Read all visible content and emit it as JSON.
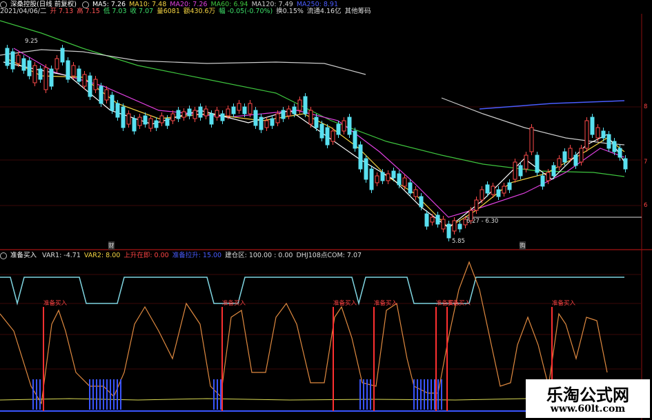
{
  "header": {
    "title": "深桑控股(日线 前复权)",
    "ma": [
      {
        "label": "MA5: 7.26",
        "color": "#ffffff"
      },
      {
        "label": "MA10: 7.48",
        "color": "#f5d442"
      },
      {
        "label": "MA20: 7.26",
        "color": "#e040e0"
      },
      {
        "label": "MA60: 6.94",
        "color": "#3ec43e"
      },
      {
        "label": "MA120: 7.49",
        "color": "#cccccc"
      },
      {
        "label": "MA250: 8.91",
        "color": "#4a5cff"
      }
    ],
    "date": "2021/04/06/二",
    "quote": [
      {
        "label": "开 7.13",
        "color": "#ff5555"
      },
      {
        "label": "高 7.15",
        "color": "#ff5555"
      },
      {
        "label": "低 7.03",
        "color": "#3ee06a"
      },
      {
        "label": "收 7.07",
        "color": "#3ee06a"
      },
      {
        "label": "量6081",
        "color": "#f5d442"
      },
      {
        "label": "额430.6万",
        "color": "#f5d442"
      },
      {
        "label": "幅 -0.05(-0.70%)",
        "color": "#3ee06a"
      },
      {
        "label": "换0.15%",
        "color": "#dddddd"
      },
      {
        "label": "流通4.16亿",
        "color": "#dddddd"
      },
      {
        "label": "其他筹码",
        "color": "#dddddd"
      }
    ]
  },
  "price_labels": {
    "high": "9.25",
    "low": "5.85",
    "mid": "6.27 - 6.30"
  },
  "axis_labels": [
    "8",
    "7",
    "6"
  ],
  "markers": {
    "left": "财",
    "right": "购"
  },
  "indicator": {
    "name": "准备买入",
    "values": [
      {
        "label": "VAR1: -4.71",
        "color": "#dddddd"
      },
      {
        "label": "VAR2: 8.00",
        "color": "#f5d442"
      },
      {
        "label": "上升在即: 0.00",
        "color": "#ff4444"
      },
      {
        "label": "准备拉升: 15.00",
        "color": "#4a5cff"
      },
      {
        "label": "建仓区: 100.00 : 0.00",
        "color": "#dddddd"
      },
      {
        "label": "DHJ108点COM: 7.07",
        "color": "#dddddd"
      }
    ],
    "signal_label": "准备买入"
  },
  "watermark": {
    "title": "乐淘公式网",
    "url": "www.60lt.com"
  }
}
